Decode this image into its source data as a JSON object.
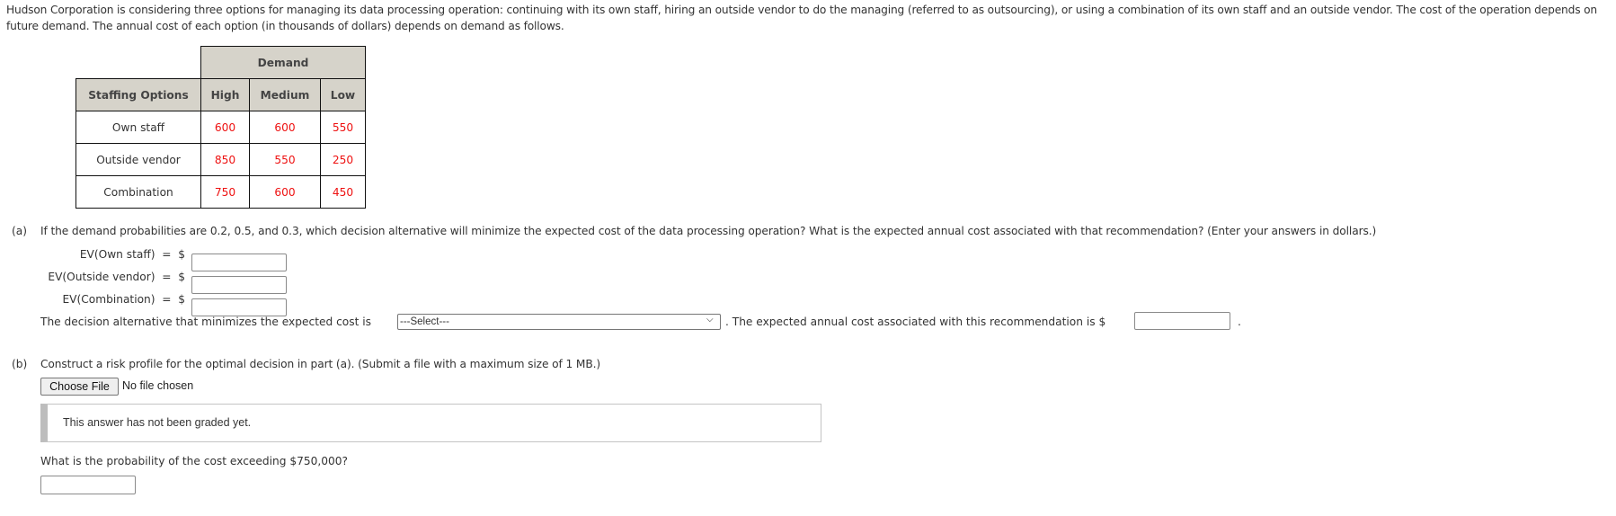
{
  "intro": {
    "text": "Hudson Corporation is considering three options for managing its data processing operation: continuing with its own staff, hiring an outside vendor to do the managing (referred to as outsourcing), or using a combination of its own staff and an outside vendor. The cost of the operation depends on future demand. The annual cost of each option (in thousands of dollars) depends on demand as follows."
  },
  "table": {
    "group_header": "Demand",
    "row_header": "Staffing Options",
    "columns": [
      "High",
      "Medium",
      "Low"
    ],
    "rows": [
      {
        "option": "Own staff",
        "values": [
          "600",
          "600",
          "550"
        ]
      },
      {
        "option": "Outside vendor",
        "values": [
          "850",
          "550",
          "250"
        ]
      },
      {
        "option": "Combination",
        "values": [
          "750",
          "600",
          "450"
        ]
      }
    ],
    "value_color": "#ee1111",
    "header_bg": "#d6d3ca"
  },
  "part_a": {
    "label": "(a)",
    "question": "If the demand probabilities are 0.2, 0.5, and 0.3, which decision alternative will minimize the expected cost of the data processing operation? What is the expected annual cost associated with that recommendation? (Enter your answers in dollars.)",
    "ev_rows": [
      {
        "label": "EV(Own staff)",
        "equals": "=",
        "currency": "$",
        "value": ""
      },
      {
        "label": "EV(Outside vendor)",
        "equals": "=",
        "currency": "$",
        "value": ""
      },
      {
        "label": "EV(Combination)",
        "equals": "=",
        "currency": "$",
        "value": ""
      }
    ],
    "decision_prefix": "The decision alternative that minimizes the expected cost is",
    "decision_select": {
      "selected": "---Select---"
    },
    "cost_text": ". The expected annual cost associated with this recommendation is $",
    "cost_value": "",
    "cost_suffix": "."
  },
  "part_b": {
    "label": "(b)",
    "question": "Construct a risk profile for the optimal decision in part (a). (Submit a file with a maximum size of 1 MB.)",
    "choose_file_label": "Choose File",
    "file_status": "No file chosen",
    "grade_message": "This answer has not been graded yet.",
    "probability_question": "What is the probability of the cost exceeding $750,000?",
    "probability_value": ""
  }
}
